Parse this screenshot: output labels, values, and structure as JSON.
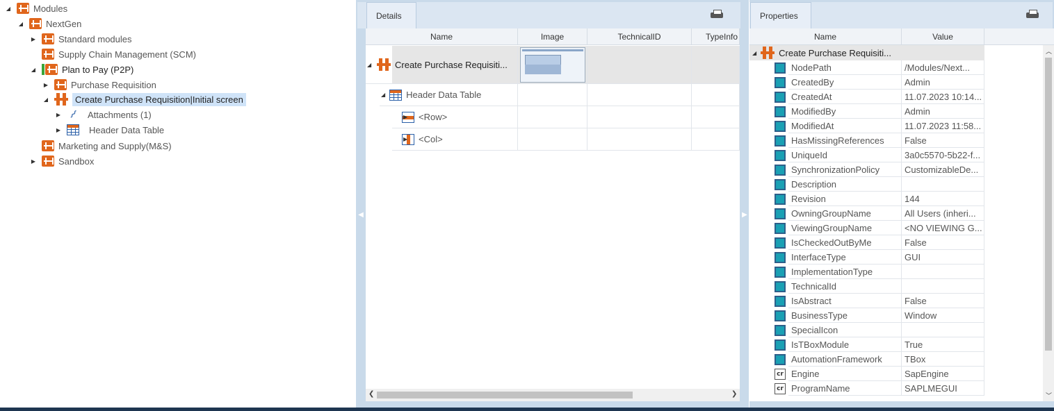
{
  "tree": {
    "items": [
      {
        "label": "Modules",
        "level": 0,
        "expanded": true,
        "icon": "module-icon"
      },
      {
        "label": "NextGen",
        "level": 1,
        "expanded": true,
        "icon": "module-icon"
      },
      {
        "label": "Standard modules",
        "level": 2,
        "expanded": false,
        "icon": "module-icon"
      },
      {
        "label": "Supply Chain Management (SCM)",
        "level": 2,
        "expanded": null,
        "icon": "module-icon"
      },
      {
        "label": "Plan to Pay (P2P)",
        "level": 2,
        "expanded": true,
        "icon": "module-icon"
      },
      {
        "label": "Purchase Requisition",
        "level": 3,
        "expanded": false,
        "icon": "module-icon"
      },
      {
        "label": "Create Purchase Requisition|Initial screen",
        "level": 3,
        "expanded": true,
        "icon": "module-icon",
        "selected": true
      },
      {
        "label": "Attachments (1)",
        "level": 4,
        "expanded": false,
        "icon": "paperclip-icon"
      },
      {
        "label": "Header Data Table",
        "level": 4,
        "expanded": false,
        "icon": "table-icon"
      },
      {
        "label": "Marketing and Supply(M&S)",
        "level": 2,
        "expanded": null,
        "icon": "module-icon"
      },
      {
        "label": "Sandbox",
        "level": 2,
        "expanded": false,
        "icon": "module-icon"
      }
    ]
  },
  "details": {
    "tab_label": "Details",
    "columns": [
      "Name",
      "Image",
      "TechnicalID",
      "TypeInfo"
    ],
    "rows": [
      {
        "name": "Create Purchase Requisiti..."
      },
      {
        "name": "Header Data Table"
      },
      {
        "name": "<Row>"
      },
      {
        "name": "<Col>"
      }
    ]
  },
  "properties": {
    "tab_label": "Properties",
    "columns": [
      "Name",
      "Value"
    ],
    "root_label": "Create Purchase Requisiti...",
    "rows": [
      {
        "name": "NodePath",
        "value": "/Modules/Next..."
      },
      {
        "name": "CreatedBy",
        "value": "Admin"
      },
      {
        "name": "CreatedAt",
        "value": "11.07.2023 10:14..."
      },
      {
        "name": "ModifiedBy",
        "value": "Admin"
      },
      {
        "name": "ModifiedAt",
        "value": "11.07.2023 11:58..."
      },
      {
        "name": "HasMissingReferences",
        "value": "False"
      },
      {
        "name": "UniqueId",
        "value": "3a0c5570-5b22-f..."
      },
      {
        "name": "SynchronizationPolicy",
        "value": "CustomizableDe..."
      },
      {
        "name": "Description",
        "value": ""
      },
      {
        "name": "Revision",
        "value": "144"
      },
      {
        "name": "OwningGroupName",
        "value": "All Users (inheri..."
      },
      {
        "name": "ViewingGroupName",
        "value": "<NO VIEWING G..."
      },
      {
        "name": "IsCheckedOutByMe",
        "value": "False"
      },
      {
        "name": "InterfaceType",
        "value": "GUI"
      },
      {
        "name": "ImplementationType",
        "value": ""
      },
      {
        "name": "TechnicalId",
        "value": ""
      },
      {
        "name": "IsAbstract",
        "value": "False"
      },
      {
        "name": "BusinessType",
        "value": "Window"
      },
      {
        "name": "SpecialIcon",
        "value": ""
      },
      {
        "name": "IsTBoxModule",
        "value": "True"
      },
      {
        "name": "AutomationFramework",
        "value": "TBox"
      },
      {
        "name": "Engine",
        "value": "SapEngine"
      },
      {
        "name": "ProgramName",
        "value": "SAPLMEGUI"
      }
    ]
  }
}
